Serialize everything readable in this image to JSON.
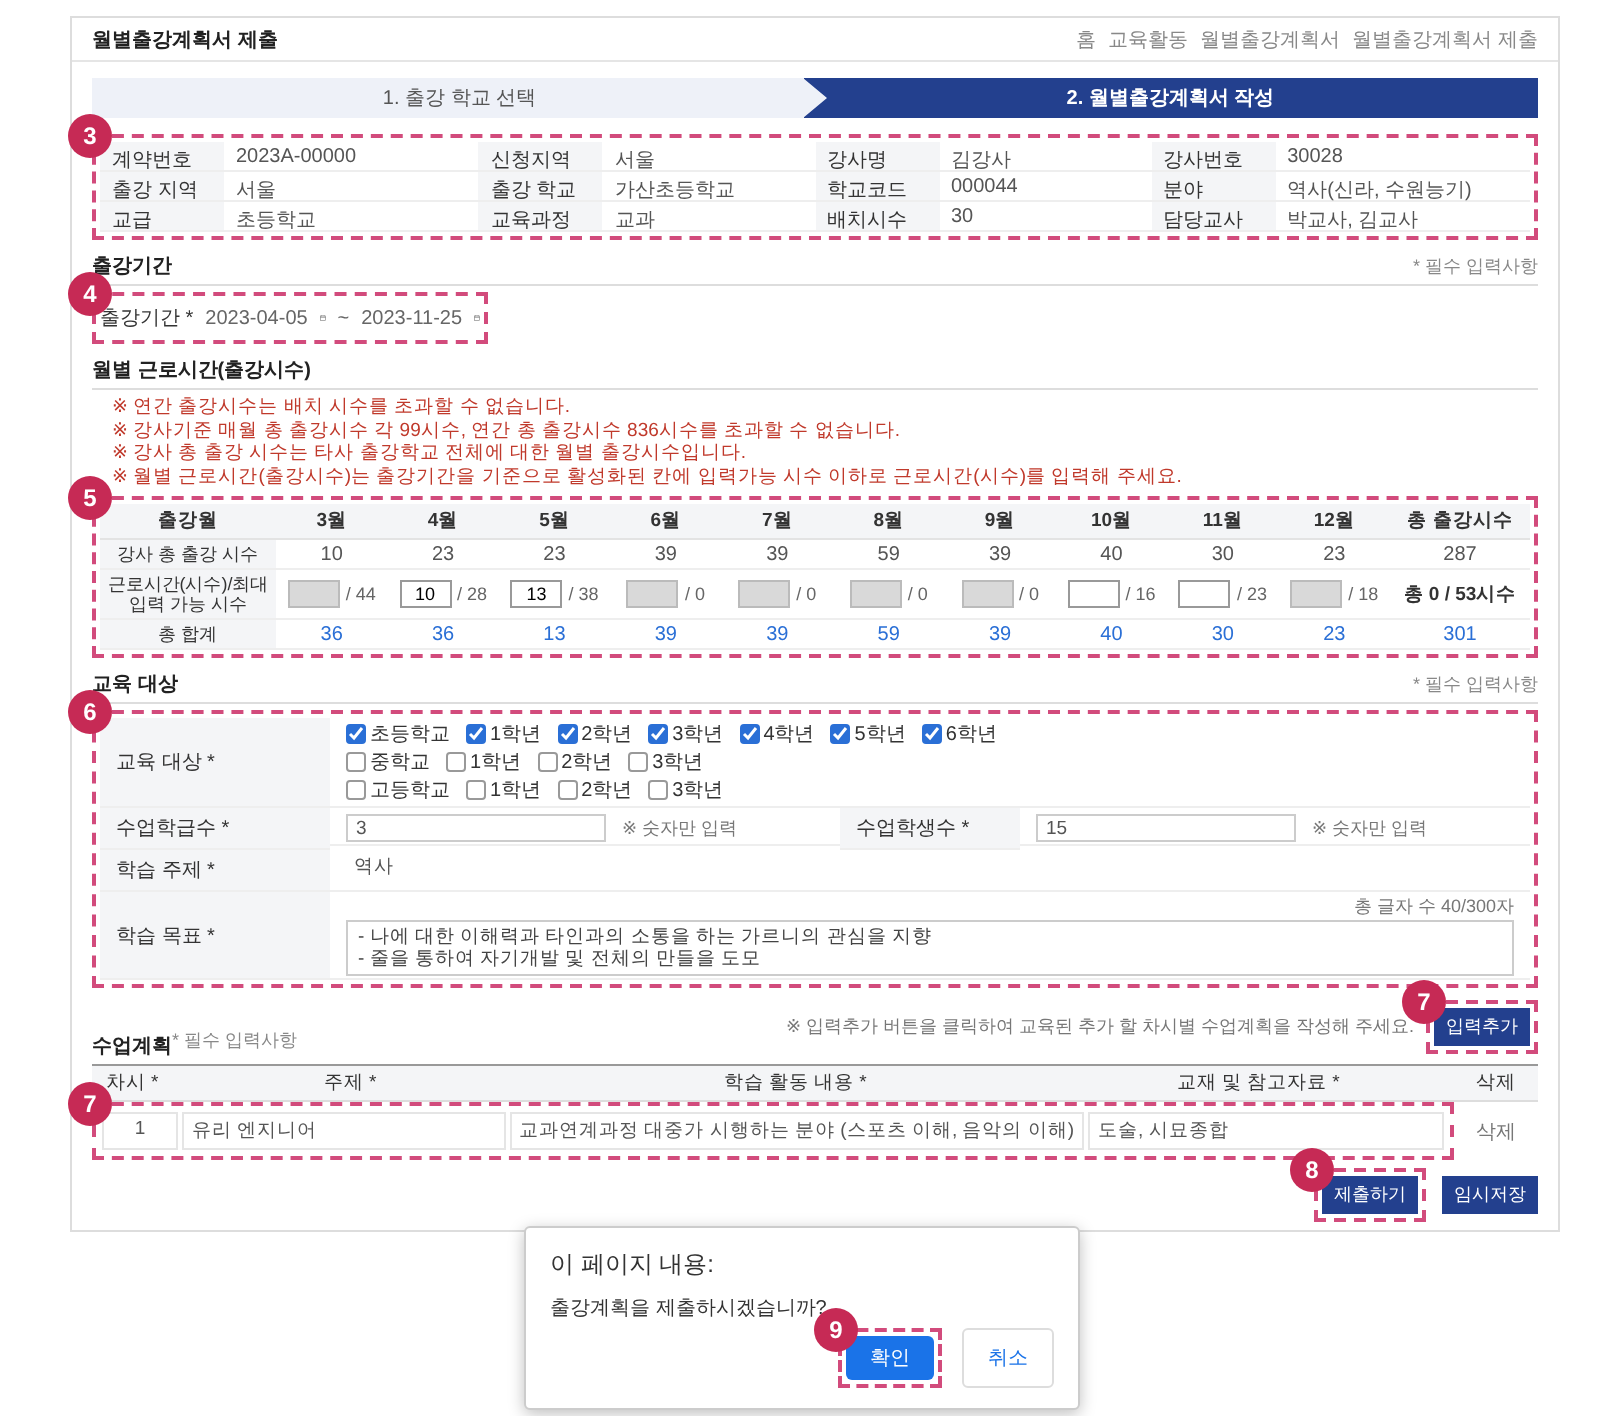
{
  "page_title": "월별출강계획서 제출",
  "breadcrumb": [
    "홈",
    "교육활동",
    "월별출강계획서",
    "월별출강계획서 제출"
  ],
  "steps": [
    {
      "label": "1. 출강 학교 선택",
      "selected": false
    },
    {
      "label": "2. 월별출강계획서 작성",
      "selected": true
    }
  ],
  "info": {
    "callout": "3",
    "fields": [
      {
        "label": "계약번호",
        "value": "2023A-00000"
      },
      {
        "label": "신청지역",
        "value": "서울"
      },
      {
        "label": "강사명",
        "value": "김강사"
      },
      {
        "label": "강사번호",
        "value": "30028"
      },
      {
        "label": "출강 지역",
        "value": "서울"
      },
      {
        "label": "출강 학교",
        "value": "가산초등학교"
      },
      {
        "label": "학교코드",
        "value": "000044"
      },
      {
        "label": "분야",
        "value": "역사(신라, 수원능기)"
      },
      {
        "label": "교급",
        "value": "초등학교"
      },
      {
        "label": "교육과정",
        "value": "교과"
      },
      {
        "label": "배치시수",
        "value": "30"
      },
      {
        "label": "담당교사",
        "value": "박교사, 김교사"
      }
    ]
  },
  "period": {
    "title": "출강기간",
    "required_note": "* 필수 입력사항",
    "callout": "4",
    "label": "출강기간 *",
    "start": "2023-04-05",
    "separator": "~",
    "end": "2023-11-25"
  },
  "monthly": {
    "title": "월별 근로시간(출강시수)",
    "callout": "5",
    "notes": [
      "※ 연간 출강시수는 배치 시수를 초과할 수 없습니다.",
      "※ 강사기준 매월 총 출강시수 각 99시수, 연간 총 출강시수 836시수를 초과할 수 없습니다.",
      "※ 강사 총 출강 시수는 타사 출강학교 전체에 대한 월별 출강시수입니다.",
      "※ 월별 근로시간(출강시수)는 출강기간을 기준으로 활성화된 칸에 입력가능 시수 이하로 근로시간(시수)를 입력해 주세요."
    ],
    "header": [
      "출강월",
      "3월",
      "4월",
      "5월",
      "6월",
      "7월",
      "8월",
      "9월",
      "10월",
      "11월",
      "12월",
      "총 출강시수"
    ],
    "rows": [
      {
        "kind": "text",
        "label": "강사 총 출강 시수",
        "cells": [
          "10",
          "23",
          "23",
          "39",
          "39",
          "59",
          "39",
          "40",
          "30",
          "23",
          "287"
        ]
      },
      {
        "kind": "inputs",
        "label": "근로시간(시수)/최대 입력 가능 시수",
        "cells": [
          {
            "max": "/ 44",
            "disabled": true
          },
          {
            "value": "10",
            "max": "/ 28",
            "disabled": false
          },
          {
            "value": "13",
            "max": "/ 38",
            "disabled": false
          },
          {
            "max": "/ 0",
            "disabled": true
          },
          {
            "max": "/ 0",
            "disabled": true
          },
          {
            "max": "/ 0",
            "disabled": true
          },
          {
            "max": "/ 0",
            "disabled": true
          },
          {
            "max": "/ 16",
            "disabled": false
          },
          {
            "max": "/ 23",
            "disabled": false
          },
          {
            "max": "/ 18",
            "disabled": true
          }
        ],
        "total": "총 0 / 53시수"
      },
      {
        "kind": "sum",
        "label": "총 합계",
        "cells": [
          "36",
          "36",
          "13",
          "39",
          "39",
          "59",
          "39",
          "40",
          "30",
          "23",
          "301"
        ]
      }
    ]
  },
  "education": {
    "title": "교육 대상",
    "required_note": "* 필수 입력사항",
    "callout": "6",
    "target_label": "교육 대상 *",
    "levels": [
      {
        "name": "초등학교",
        "checked": true,
        "grades": [
          {
            "label": "1학년",
            "checked": true
          },
          {
            "label": "2학년",
            "checked": true
          },
          {
            "label": "3학년",
            "checked": true
          },
          {
            "label": "4학년",
            "checked": true
          },
          {
            "label": "5학년",
            "checked": true
          },
          {
            "label": "6학년",
            "checked": true
          }
        ]
      },
      {
        "name": "중학교",
        "checked": false,
        "grades": [
          {
            "label": "1학년",
            "checked": false
          },
          {
            "label": "2학년",
            "checked": false
          },
          {
            "label": "3학년",
            "checked": false
          }
        ]
      },
      {
        "name": "고등학교",
        "checked": false,
        "grades": [
          {
            "label": "1학년",
            "checked": false
          },
          {
            "label": "2학년",
            "checked": false
          },
          {
            "label": "3학년",
            "checked": false
          }
        ]
      }
    ],
    "counts": [
      {
        "label": "수업학급수 *",
        "value": "3",
        "hint": "※ 숫자만 입력"
      },
      {
        "label": "수업학생수 *",
        "value": "15",
        "hint": "※ 숫자만 입력"
      }
    ],
    "topic": {
      "label": "학습 주제 *",
      "value": "역사"
    },
    "goal": {
      "label": "학습 목표 *",
      "counter": "총 글자 수 40/300자",
      "lines": [
        "- 나에 대한 이해력과 타인과의 소통을 하는 가르니의 관심을 지향",
        "- 줄을 통하여 자기개발 및 전체의 만들을 도모"
      ]
    }
  },
  "plan": {
    "title": "수업계획",
    "required_note": "* 필수 입력사항",
    "hint": "※ 입력추가 버튼을 클릭하여 교육된 추가 할 차시별 수업계획을 작성해 주세요.",
    "add_button": "입력추가",
    "add_callout": "7",
    "columns": [
      "차시 *",
      "주제 *",
      "학습 활동 내용 *",
      "교재 및 참고자료 *",
      "삭제"
    ],
    "row_callout": "7",
    "rows": [
      {
        "cells": [
          "1",
          "유리 엔지니어",
          "교과연계과정 대중가 시행하는 분야 (스포츠 이해, 음악의 이해)",
          "도술, 시묘종합"
        ],
        "delete": "삭제"
      }
    ],
    "submit": "제출하기",
    "submit_callout": "8",
    "save": "임시저장"
  },
  "dialog": {
    "title": "이 페이지 내용:",
    "message": "출강계획을 제출하시겠습니까?",
    "confirm": "확인",
    "cancel": "취소",
    "callout": "9"
  }
}
